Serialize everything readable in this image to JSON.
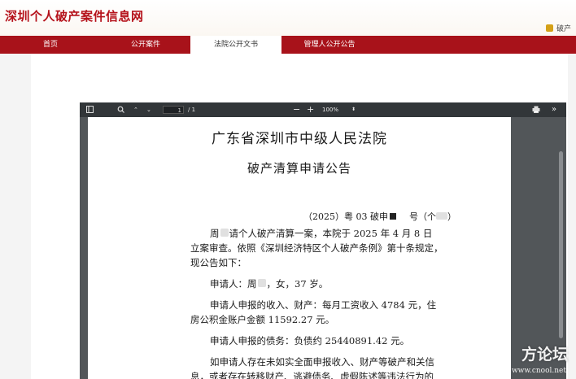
{
  "site": {
    "title": "深圳个人破产案件信息网",
    "user_label": "破产"
  },
  "nav": {
    "items": [
      "首页",
      "公开案件",
      "法院公开文书",
      "管理人公开公告"
    ],
    "active_index": 2
  },
  "pdf_toolbar": {
    "page_current": "1",
    "page_total": "/ 1",
    "zoom": "100%"
  },
  "document": {
    "court": "广东省深圳市中级人民法院",
    "title": "破产清算申请公告",
    "case_no_a": "（2025）粤 03 破申",
    "case_no_b": "号（个",
    "case_no_c": "）",
    "lines": [
      {
        "pre": "周",
        "post": "请个人破产清算一案，本院于 2025 年 4 月 8 日"
      },
      {
        "pre": "",
        "post": "立案审查。依照《深圳经济特区个人破产条例》第十条规定，"
      },
      {
        "pre": "",
        "post": "现公告如下："
      },
      {
        "pre": "申请人：周",
        "post": "，女，37 岁。"
      },
      {
        "pre": "",
        "post": "申请人申报的收入、财产：每月工资收入 4784 元，住"
      },
      {
        "pre": "",
        "post": "房公积金账户金额 11592.27 元。"
      },
      {
        "pre": "",
        "post": "申请人申报的债务：负债约 25440891.42 元。"
      },
      {
        "pre": "",
        "post": "如申请人存在未如实全面申报收入、财产等破产和关信"
      },
      {
        "pre": "",
        "post": "息，或者存在转移财产、逃避债务、虚假陈述等违法行为的"
      }
    ]
  },
  "watermark": {
    "main": "方论坛",
    "sub": "www.cnool.net"
  },
  "colors": {
    "brand_red": "#a8121a",
    "title_red": "#b5121b"
  }
}
